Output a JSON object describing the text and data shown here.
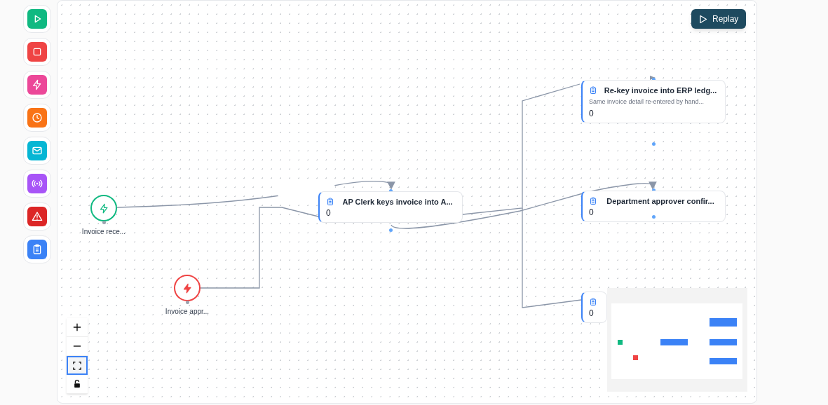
{
  "palette": [
    {
      "kind": "play",
      "color": "#10b981"
    },
    {
      "kind": "stop",
      "color": "#ef4444"
    },
    {
      "kind": "bolt",
      "color": "#ec4899"
    },
    {
      "kind": "clock",
      "color": "#f97316"
    },
    {
      "kind": "mail",
      "color": "#06b6d4"
    },
    {
      "kind": "broadcast",
      "color": "#a855f7"
    },
    {
      "kind": "warning",
      "color": "#dc2626"
    },
    {
      "kind": "clipboard",
      "color": "#3b82f6"
    }
  ],
  "replay_button": {
    "label": "Replay"
  },
  "nodes": [
    {
      "kind": "event",
      "color": "#10b981",
      "label": "Invoice rece..."
    },
    {
      "kind": "event",
      "color": "#ef4444",
      "label": "Invoice appr..."
    },
    {
      "kind": "task",
      "title": "AP Clerk keys invoice into A...",
      "count": "0"
    },
    {
      "kind": "task",
      "title": "Re-key invoice into ERP ledg...",
      "description": "Same invoice detail re-entered by hand...",
      "count": "0"
    },
    {
      "kind": "task",
      "title": "Department approver confir...",
      "count": "0"
    },
    {
      "kind": "task",
      "count": "0"
    }
  ],
  "zoom_controls": [
    {
      "kind": "zoom_in",
      "selected": false
    },
    {
      "kind": "zoom_out",
      "selected": false
    },
    {
      "kind": "fit",
      "selected": true
    },
    {
      "kind": "lock",
      "selected": false
    }
  ]
}
